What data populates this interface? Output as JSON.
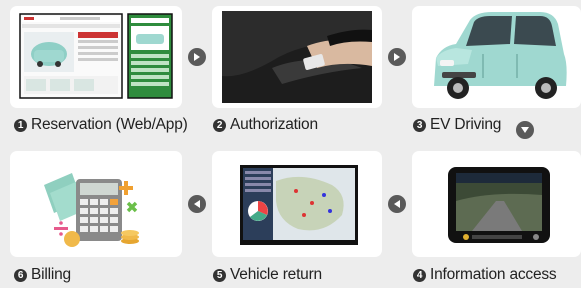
{
  "steps": [
    {
      "num": "1",
      "label": "Reservation (Web/App)"
    },
    {
      "num": "2",
      "label": "Authorization"
    },
    {
      "num": "3",
      "label": "EV Driving"
    },
    {
      "num": "4",
      "label": "Information access"
    },
    {
      "num": "5",
      "label": "Vehicle return"
    },
    {
      "num": "6",
      "label": "Billing"
    }
  ],
  "arrows": [
    "arrow-right-icon",
    "arrow-right-icon",
    "arrow-down-icon",
    "arrow-left-icon",
    "arrow-left-icon"
  ],
  "colors": {
    "background": "#ededed",
    "card": "#ffffff",
    "accent_green": "#2e8b3e",
    "car": "#9fd8d0"
  }
}
